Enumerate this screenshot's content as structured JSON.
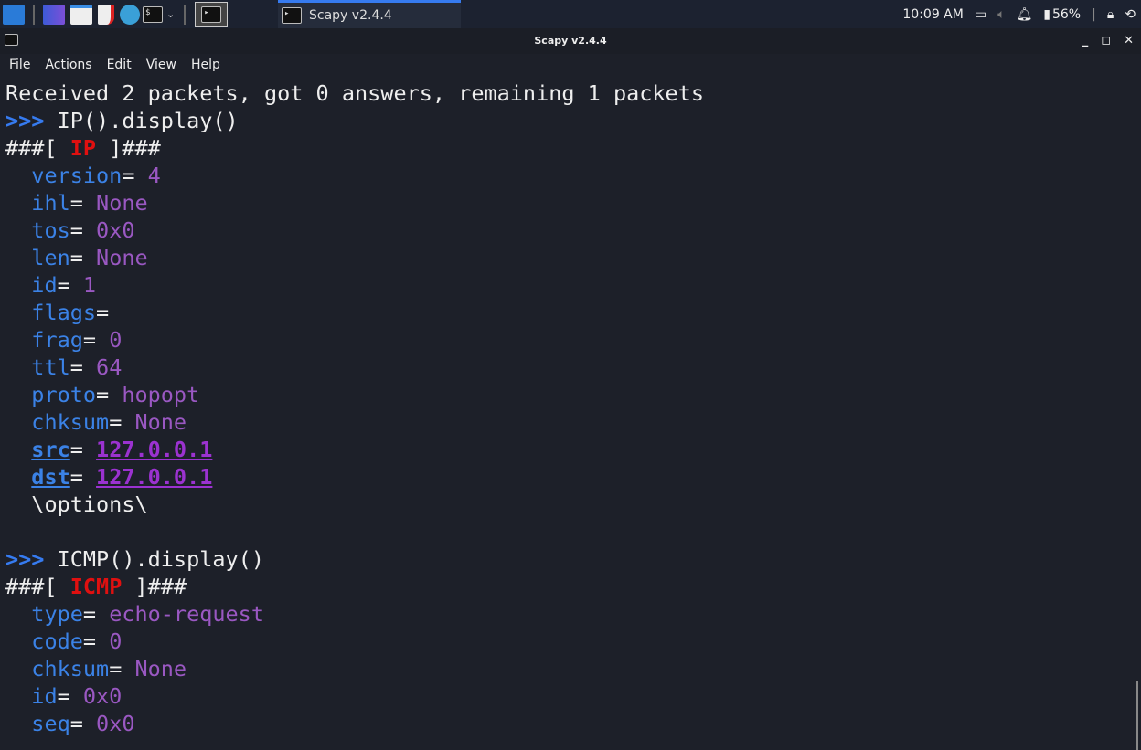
{
  "taskbar": {
    "active_task": "Scapy v2.4.4",
    "clock": "10:09 AM",
    "battery": "56%"
  },
  "window": {
    "title": "Scapy v2.4.4"
  },
  "menu": [
    "File",
    "Actions",
    "Edit",
    "View",
    "Help"
  ],
  "terminal": {
    "status": "Received 2 packets, got 0 answers, remaining 1 packets",
    "prompt": ">>>",
    "cmd1": "IP().display()",
    "hdr1": "IP",
    "ip_fields": [
      [
        "version",
        "4"
      ],
      [
        "ihl",
        "None"
      ],
      [
        "tos",
        "0x0"
      ],
      [
        "len",
        "None"
      ],
      [
        "id",
        "1"
      ],
      [
        "flags",
        ""
      ],
      [
        "frag",
        "0"
      ],
      [
        "ttl",
        "64"
      ],
      [
        "proto",
        "hopopt"
      ],
      [
        "chksum",
        "None"
      ]
    ],
    "src": [
      "src",
      "127.0.0.1"
    ],
    "dst": [
      "dst",
      "127.0.0.1"
    ],
    "options": "\\options\\",
    "cmd2": "ICMP().display()",
    "hdr2": "ICMP",
    "icmp_fields": [
      [
        "type",
        "echo-request"
      ],
      [
        "code",
        "0"
      ],
      [
        "chksum",
        "None"
      ],
      [
        "id",
        "0x0"
      ],
      [
        "seq",
        "0x0"
      ]
    ]
  }
}
